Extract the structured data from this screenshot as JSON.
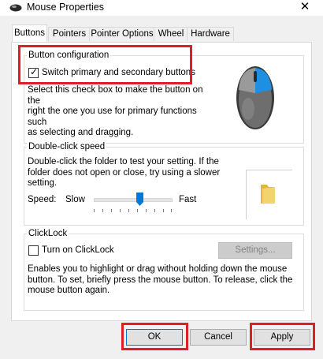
{
  "window": {
    "title": "Mouse Properties",
    "close_glyph": "✕"
  },
  "tabs": [
    {
      "label": "Buttons",
      "active": true
    },
    {
      "label": "Pointers",
      "active": false
    },
    {
      "label": "Pointer Options",
      "active": false
    },
    {
      "label": "Wheel",
      "active": false
    },
    {
      "label": "Hardware",
      "active": false
    }
  ],
  "button_config": {
    "title": "Button configuration",
    "checkbox_label": "Switch primary and secondary buttons",
    "checked": true,
    "description_lines": [
      "Select this check box to make the button on the",
      "right the one you use for primary functions such",
      "as selecting and dragging."
    ]
  },
  "double_click": {
    "title": "Double-click speed",
    "description_lines": [
      "Double-click the folder to test your setting. If the",
      "folder does not open or close, try using a slower",
      "setting."
    ],
    "speed_label": "Speed:",
    "slow_label": "Slow",
    "fast_label": "Fast",
    "speed_value": 0.6
  },
  "clicklock": {
    "title": "ClickLock",
    "checkbox_label": "Turn on ClickLock",
    "checked": false,
    "settings_label": "Settings...",
    "description_lines": [
      "Enables you to highlight or drag without holding down the mouse",
      "button. To set, briefly press the mouse button. To release, click the",
      "mouse button again."
    ]
  },
  "footer": {
    "ok_label": "OK",
    "cancel_label": "Cancel",
    "apply_label": "Apply"
  },
  "colors": {
    "highlight": "#e01e26",
    "mouse_accent": "#1e8fe1",
    "folder": "#f3d36b"
  }
}
